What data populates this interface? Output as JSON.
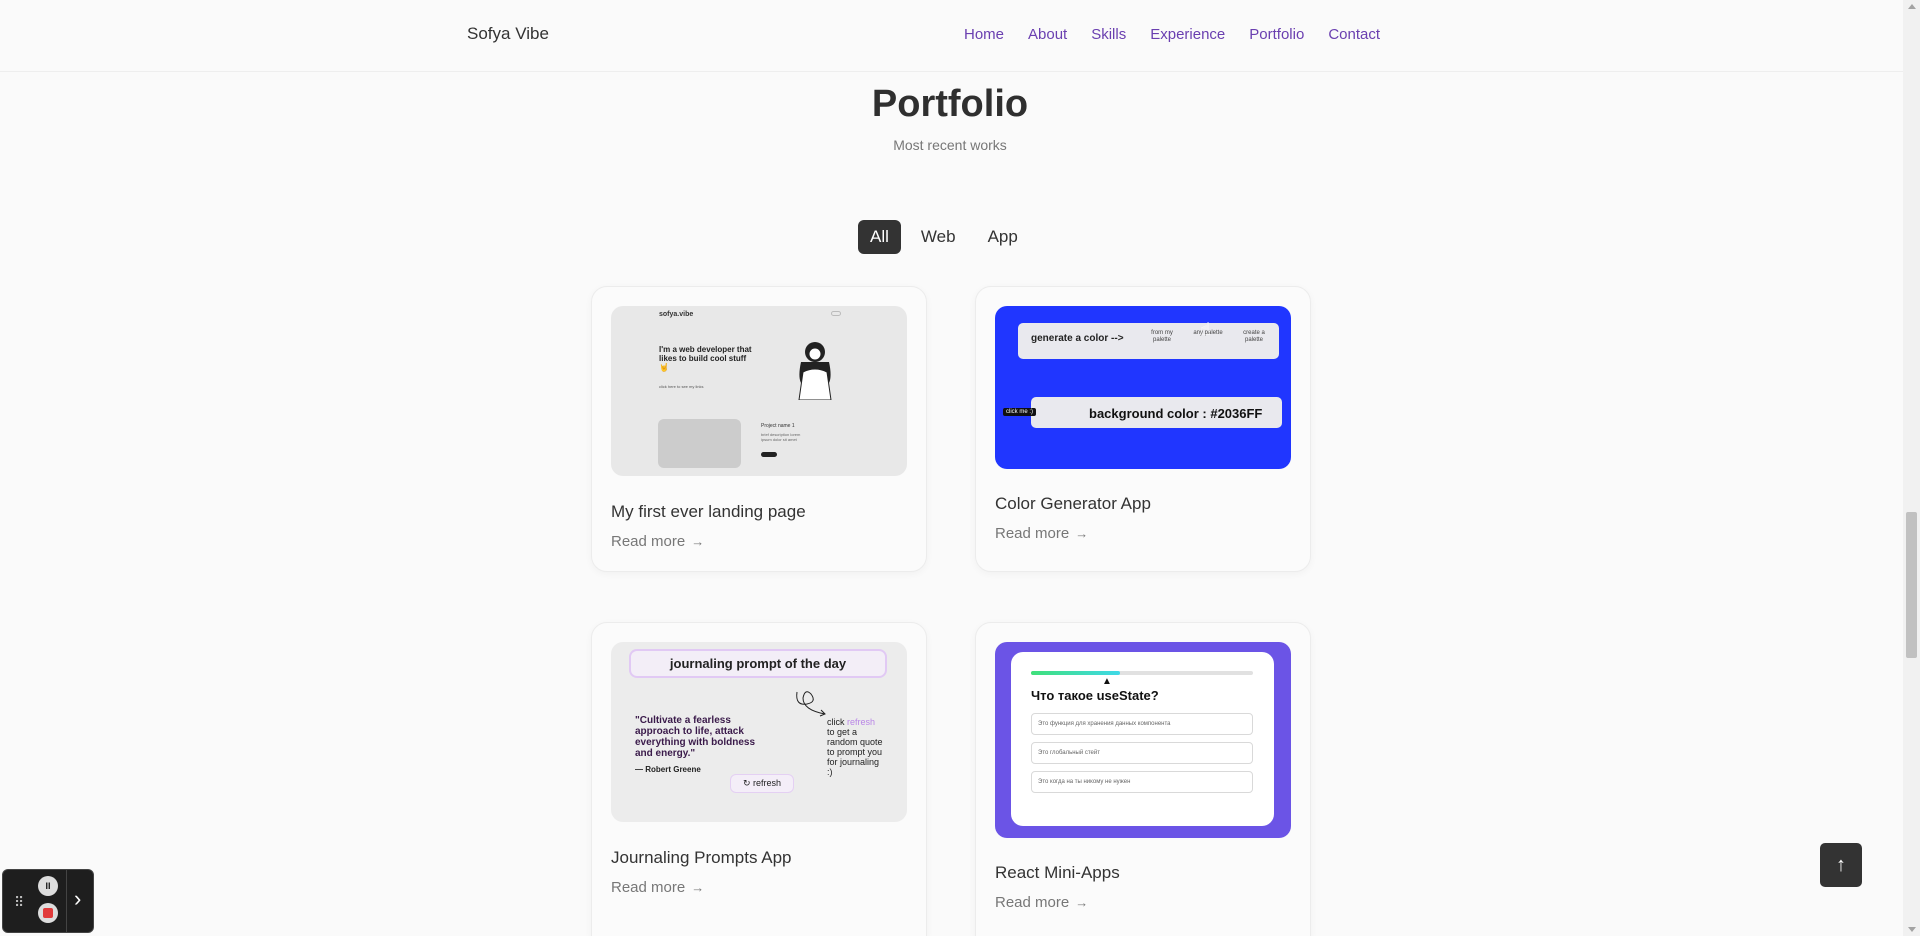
{
  "header": {
    "logo": "Sofya Vibe",
    "nav": [
      "Home",
      "About",
      "Skills",
      "Experience",
      "Portfolio",
      "Contact"
    ]
  },
  "section": {
    "title": "Portfolio",
    "subtitle": "Most recent works"
  },
  "filters": [
    {
      "label": "All",
      "active": true
    },
    {
      "label": "Web",
      "active": false
    },
    {
      "label": "App",
      "active": false
    }
  ],
  "cards": [
    {
      "title": "My first ever landing page",
      "read_more": "Read more",
      "thumb": {
        "logo": "sofya.vibe",
        "hero": "I'm a web developer that likes to build cool stuff 🤘",
        "click": "click here to see my links",
        "project_name": "Project name 1",
        "project_desc": "brief description lorem ipsum dolor sit amet"
      }
    },
    {
      "title": "Color Generator App",
      "read_more": "Read more",
      "thumb": {
        "generate": "generate a color -->",
        "options": [
          "from my palette",
          "any palette",
          "create a palette"
        ],
        "background": "background color : #2036FF",
        "click_me": "click me :)"
      }
    },
    {
      "title": "Journaling Prompts App",
      "read_more": "Read more",
      "thumb": {
        "heading": "journaling prompt of the day",
        "quote": "\"Cultivate a fearless approach to life, attack everything with boldness and energy.\"",
        "author": "— Robert Greene",
        "refresh": "refresh",
        "side_prefix": "click ",
        "side_accent": "refresh",
        "side_rest": " to get a random quote to prompt you for journaling :)"
      }
    },
    {
      "title": "React Mini-Apps",
      "read_more": "Read more",
      "thumb": {
        "question": "Что такое useState?",
        "progress": 0.4,
        "answers": [
          "Это функция для хранения данных компонента",
          "Это глобальный стейт",
          "Это когда на ты никому не нужен"
        ]
      }
    }
  ],
  "widgets": {
    "back_to_top": "↑"
  },
  "icons": {
    "read_more_arrow": "→",
    "grip": "⠿",
    "pause": "II",
    "next": "›",
    "hand": "☝",
    "pointer": "▲",
    "refresh_icon": "↻"
  },
  "colors": {
    "nav": "#6a3fb0",
    "active_filter": "#333333",
    "color_app_bg": "#2036ff",
    "react_bg": "#6b54e6"
  }
}
